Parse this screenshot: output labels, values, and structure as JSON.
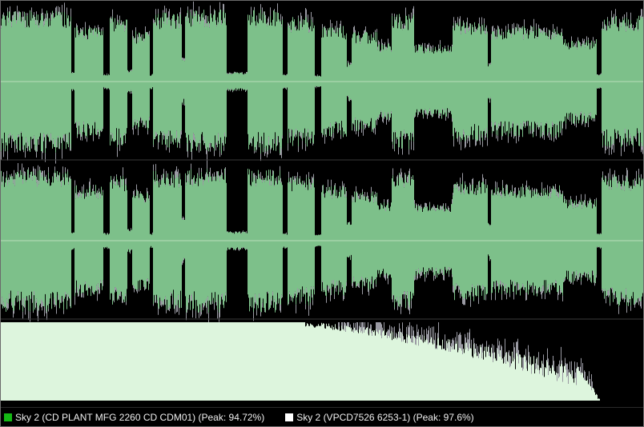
{
  "colors": {
    "background": "#000000",
    "wave_green": "#7dc08a",
    "wave_grey": "#9a9aa3",
    "centerline": "#c8e6c8",
    "spectrum_fill": "#ddf5dd",
    "accent_green": "#14b914",
    "accent_white": "#ffffff"
  },
  "legend": [
    {
      "label": "Sky 2 (CD PLANT MFG 2260 CD CDM01) (Peak: 94.72%)",
      "color": "#14b914",
      "icon": "green-square-icon"
    },
    {
      "label": "Sky 2 (VPCD7526 6253-1) (Peak: 97.6%)",
      "color": "#ffffff",
      "icon": "white-square-icon"
    }
  ]
}
